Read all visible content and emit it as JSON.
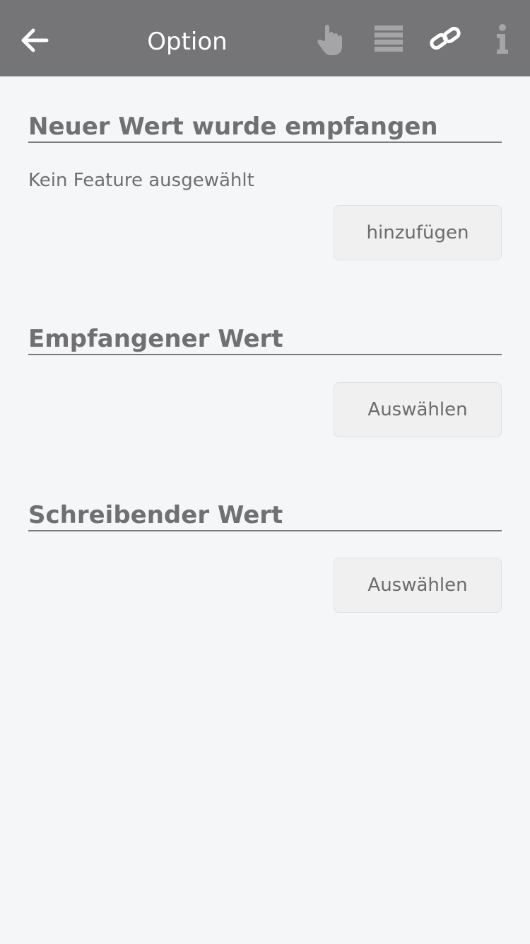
{
  "header": {
    "title": "Option",
    "icons": {
      "back": "arrow-left-icon",
      "touch": "hand-pointer-icon",
      "list": "list-icon",
      "link": "link-icon",
      "info": "info-icon"
    },
    "colors": {
      "bar_background": "#757577",
      "icon_active": "#ffffff",
      "icon_inactive": "#a5a5a7"
    }
  },
  "sections": [
    {
      "heading": "Neuer Wert wurde empfangen",
      "status": "Kein Feature ausgewählt",
      "button_label": "hinzufügen"
    },
    {
      "heading": "Empfangener Wert",
      "button_label": "Auswählen"
    },
    {
      "heading": "Schreibender Wert",
      "button_label": "Auswählen"
    }
  ]
}
